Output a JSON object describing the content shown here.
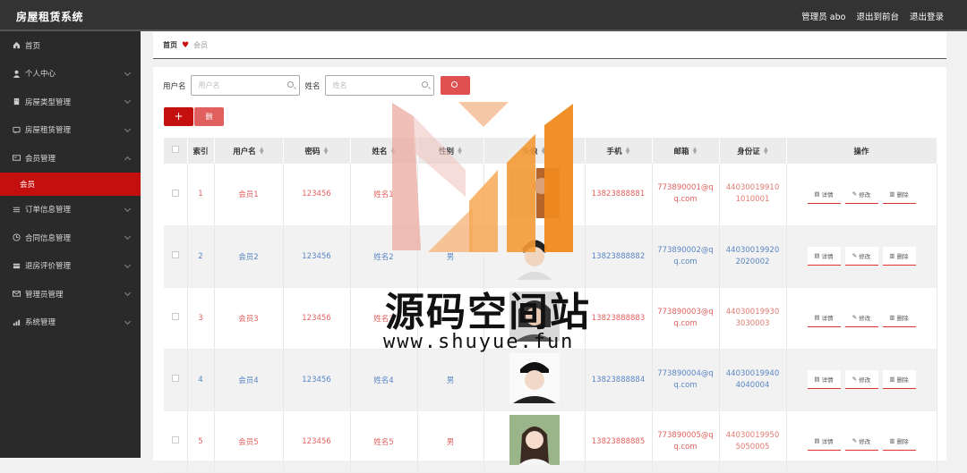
{
  "app": {
    "title": "房屋租赁系统"
  },
  "topbar": {
    "user": "管理员 abo",
    "back_front": "退出到前台",
    "logout": "退出登录"
  },
  "sidebar": {
    "items": [
      {
        "label": "首页",
        "icon": "home-icon",
        "has_children": false
      },
      {
        "label": "个人中心",
        "icon": "person-icon",
        "has_children": true
      },
      {
        "label": "房屋类型管理",
        "icon": "building-icon",
        "has_children": true
      },
      {
        "label": "房屋租赁管理",
        "icon": "chat-icon",
        "has_children": true
      },
      {
        "label": "会员管理",
        "icon": "card-icon",
        "has_children": true,
        "expanded": true
      }
    ],
    "sub_active": "会员",
    "items_after": [
      {
        "label": "订单信息管理",
        "icon": "list-icon"
      },
      {
        "label": "合同信息管理",
        "icon": "clock-icon"
      },
      {
        "label": "退房评价管理",
        "icon": "stack-icon"
      },
      {
        "label": "管理员管理",
        "icon": "mail-icon"
      },
      {
        "label": "系统管理",
        "icon": "chart-icon"
      }
    ]
  },
  "breadcrumb": {
    "home": "首页",
    "current": "会员"
  },
  "search": {
    "username_label": "用户名",
    "username_placeholder": "用户名",
    "name_label": "姓名",
    "name_placeholder": "姓名"
  },
  "actions": {
    "add": "+",
    "delete": "删"
  },
  "table": {
    "headers": [
      "索引",
      "用户名",
      "密码",
      "姓名",
      "性别",
      "头像",
      "手机",
      "邮箱",
      "身份证",
      "操作"
    ],
    "op_labels": {
      "detail": "详情",
      "edit": "修改",
      "delete": "删除"
    },
    "rows": [
      {
        "index": "1",
        "username": "会员1",
        "password": "123456",
        "name": "姓名1",
        "gender": "",
        "phone": "13823888881",
        "email": "773890001@qq.com",
        "idcard": "440300199101010001"
      },
      {
        "index": "2",
        "username": "会员2",
        "password": "123456",
        "name": "姓名2",
        "gender": "男",
        "phone": "13823888882",
        "email": "773890002@qq.com",
        "idcard": "440300199202020002"
      },
      {
        "index": "3",
        "username": "会员3",
        "password": "123456",
        "name": "姓名3",
        "gender": "",
        "phone": "13823888883",
        "email": "773890003@qq.com",
        "idcard": "440300199303030003"
      },
      {
        "index": "4",
        "username": "会员4",
        "password": "123456",
        "name": "姓名4",
        "gender": "男",
        "phone": "13823888884",
        "email": "773890004@qq.com",
        "idcard": "440300199404040004"
      },
      {
        "index": "5",
        "username": "会员5",
        "password": "123456",
        "name": "姓名5",
        "gender": "男",
        "phone": "13823888885",
        "email": "773890005@qq.com",
        "idcard": "440300199505050005"
      }
    ]
  },
  "watermark": {
    "text": "源码空间站",
    "url": "www.shuyue.fun"
  },
  "colors": {
    "accent": "#c40f0f",
    "topbar": "#333333",
    "sidebar": "#2a2a2a"
  }
}
